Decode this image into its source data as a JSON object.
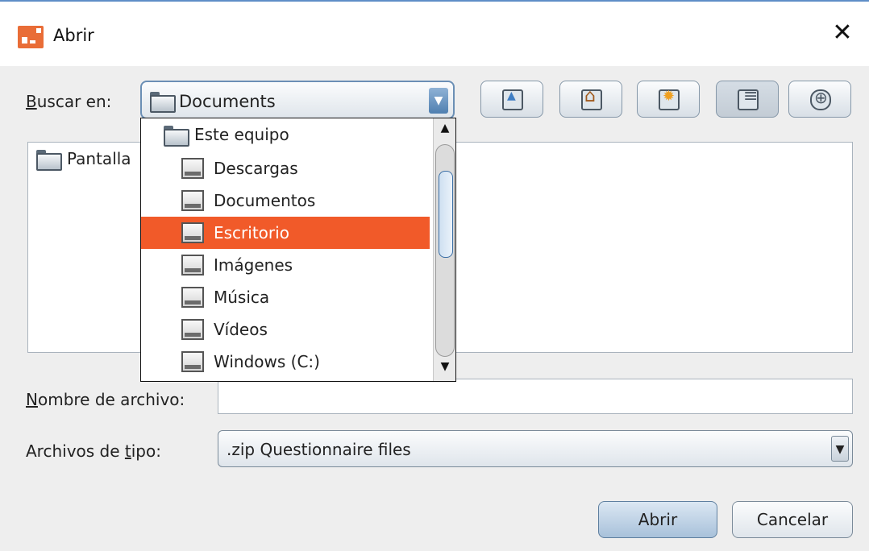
{
  "window": {
    "title": "Abrir",
    "close_glyph": "✕"
  },
  "look_in": {
    "label_prefix": "B",
    "label_rest": "uscar en:",
    "value": "Documents"
  },
  "toolbar": {
    "icons": [
      "up-folder-icon",
      "home-icon",
      "new-folder-icon",
      "list-view-icon",
      "details-view-icon"
    ],
    "pressed": "list-view-icon"
  },
  "file_list": {
    "items": [
      {
        "label": "Pantalla",
        "icon": "folder-icon"
      }
    ]
  },
  "dropdown": {
    "items": [
      {
        "label": "Este equipo",
        "icon": "folder-icon",
        "level": 0
      },
      {
        "label": "Descargas",
        "icon": "drive-icon",
        "level": 1
      },
      {
        "label": "Documentos",
        "icon": "drive-icon",
        "level": 1
      },
      {
        "label": "Escritorio",
        "icon": "drive-icon",
        "level": 1,
        "selected": true
      },
      {
        "label": "Imágenes",
        "icon": "drive-icon",
        "level": 1
      },
      {
        "label": "Música",
        "icon": "drive-icon",
        "level": 1
      },
      {
        "label": "Vídeos",
        "icon": "drive-icon",
        "level": 1
      },
      {
        "label": "Windows (C:)",
        "icon": "drive-icon",
        "level": 1
      }
    ],
    "selected_color": "#f15a29"
  },
  "file_name": {
    "label_prefix": "N",
    "label_rest": "ombre de archivo:",
    "value": ""
  },
  "file_type": {
    "label_start": "Archivos de ",
    "label_underlined": "t",
    "label_end": "ipo:",
    "value": ".zip Questionnaire files"
  },
  "buttons": {
    "open": "Abrir",
    "cancel": "Cancelar"
  },
  "colors": {
    "accent": "#f15a29",
    "title_border": "#5e8ec7"
  }
}
